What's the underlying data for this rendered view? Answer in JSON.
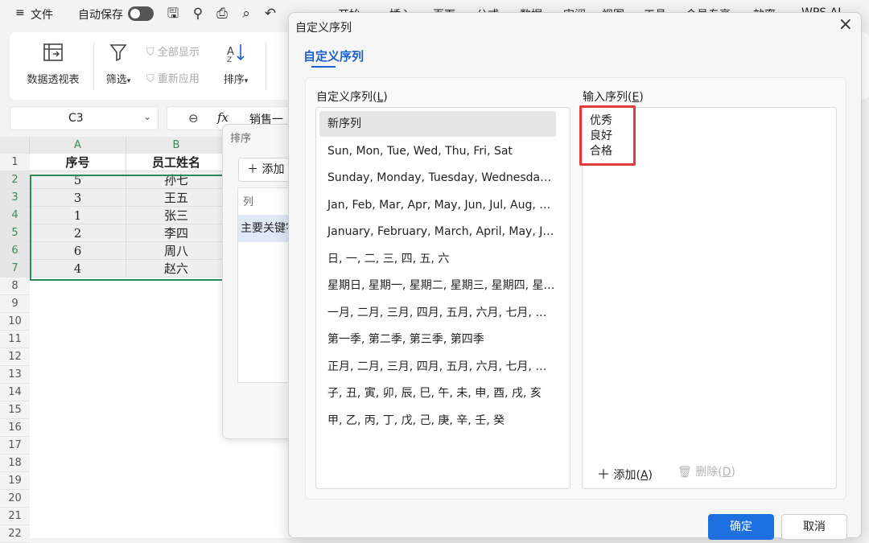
{
  "menubar": {
    "menu_icon": "≡",
    "file": "文件",
    "autosave": "自动保存",
    "tabs": [
      "开始",
      "插入",
      "页面",
      "公式",
      "数据",
      "审阅",
      "视图",
      "工具",
      "会员专享",
      "效率",
      "WPS AI"
    ]
  },
  "ribbon": {
    "pivot": "数据透视表",
    "filter": "筛选",
    "show_all": "全部显示",
    "reapply": "重新应用",
    "sort": "排序"
  },
  "formula_bar": {
    "cell_ref": "C3",
    "fx": "fx",
    "content": "销售一"
  },
  "sheet": {
    "columns": [
      "A",
      "B"
    ],
    "rows": [
      "1",
      "2",
      "3",
      "4",
      "5",
      "6",
      "7",
      "8",
      "9",
      "10",
      "11",
      "12",
      "13",
      "14",
      "15",
      "16",
      "17",
      "18",
      "19",
      "20",
      "21",
      "22"
    ],
    "header": [
      "序号",
      "员工姓名"
    ],
    "data": [
      [
        "5",
        "孙七"
      ],
      [
        "3",
        "王五"
      ],
      [
        "1",
        "张三"
      ],
      [
        "2",
        "李四"
      ],
      [
        "6",
        "周八"
      ],
      [
        "4",
        "赵六"
      ]
    ]
  },
  "sort_dialog": {
    "title": "排序",
    "add": "添加",
    "col_header": "列",
    "primary_key": "主要关键字"
  },
  "custom_list_dialog": {
    "title": "自定义序列",
    "tab": "自定义序列",
    "list_label": "自定义序列(L)",
    "entries_label": "输入序列(E)",
    "lists": [
      "新序列",
      "Sun, Mon, Tue, Wed, Thu, Fri, Sat",
      "Sunday, Monday, Tuesday, Wednesday, Thursday, Friday, Saturday",
      "Jan, Feb, Mar, Apr, May, Jun, Jul, Aug, Sep, Oct, Nov, Dec",
      "January, February, March, April, May, June, July, August, September, October, November, December",
      "日, 一, 二, 三, 四, 五, 六",
      "星期日, 星期一, 星期二, 星期三, 星期四, 星期五, 星期六",
      "一月, 二月, 三月, 四月, 五月, 六月, 七月, 八月, 九月, 十月, 十一月, 十二月",
      "第一季, 第二季, 第三季, 第四季",
      "正月, 二月, 三月, 四月, 五月, 六月, 七月, 八月, 九月, 十月, 冬月, 腊月",
      "子, 丑, 寅, 卯, 辰, 巳, 午, 未, 申, 酉, 戌, 亥",
      "甲, 乙, 丙, 丁, 戊, 己, 庚, 辛, 壬, 癸"
    ],
    "entries": [
      "优秀",
      "良好",
      "合格"
    ],
    "add_button": "添加(A)",
    "delete_button": "删除(D)",
    "ok": "确定",
    "cancel": "取消"
  }
}
